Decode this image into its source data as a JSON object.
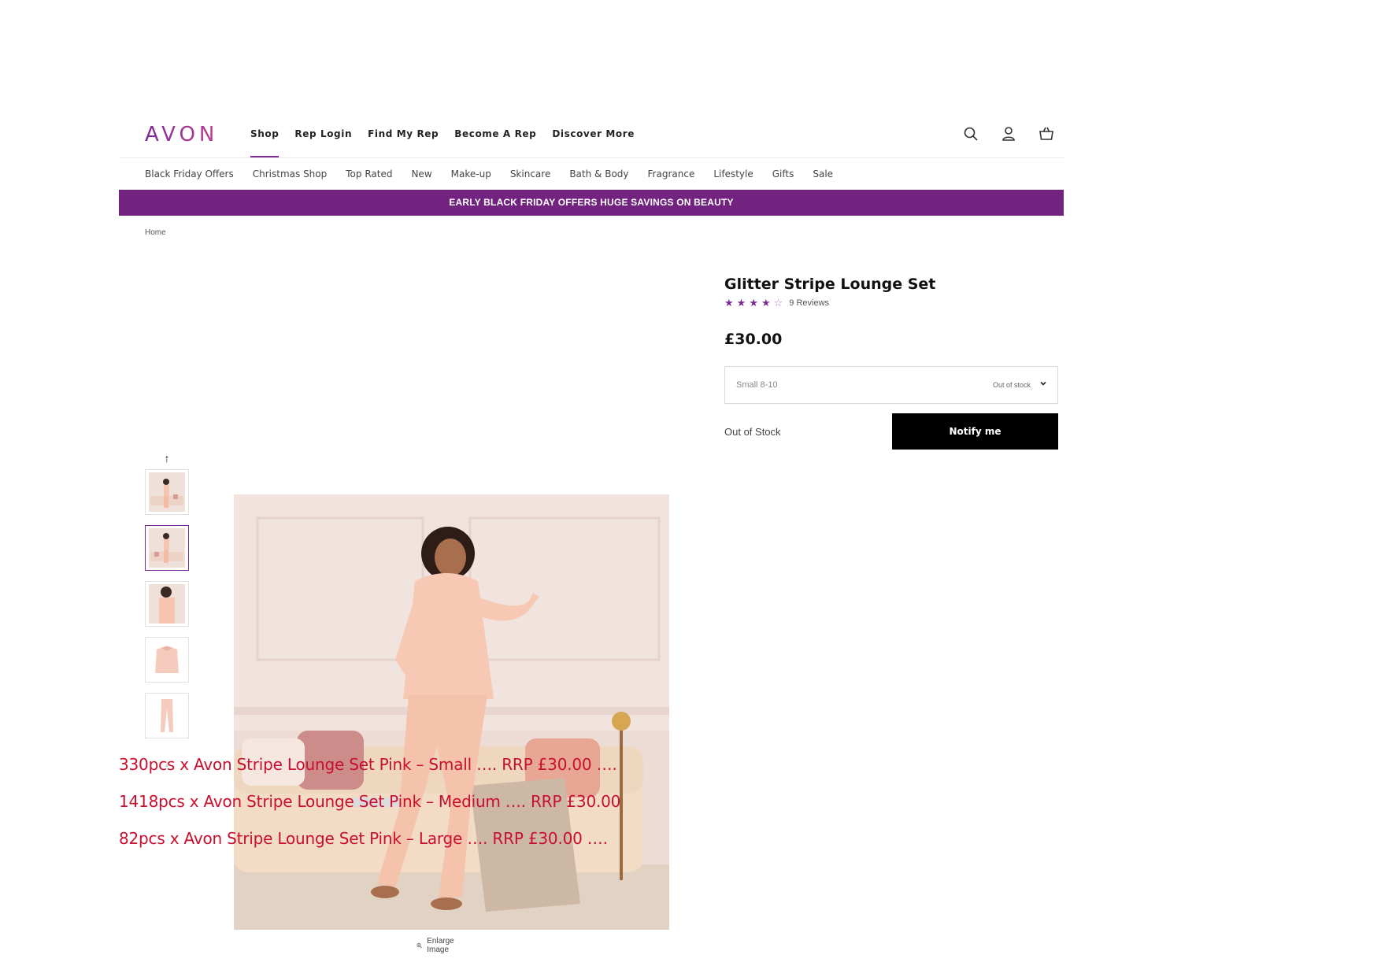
{
  "header": {
    "logo": "AVON",
    "nav": [
      "Shop",
      "Rep Login",
      "Find My Rep",
      "Become A Rep",
      "Discover More"
    ],
    "active_nav": "Shop",
    "icons": [
      "search-icon",
      "account-icon",
      "basket-icon"
    ]
  },
  "categories": [
    "Black Friday Offers",
    "Christmas Shop",
    "Top Rated",
    "New",
    "Make-up",
    "Skincare",
    "Bath & Body",
    "Fragrance",
    "Lifestyle",
    "Gifts",
    "Sale"
  ],
  "promo": "EARLY BLACK FRIDAY OFFERS  HUGE SAVINGS ON BEAUTY",
  "breadcrumb": "Home",
  "gallery": {
    "enlarge_label": "Enlarge Image",
    "selected_thumb": 2,
    "thumb_count": 5
  },
  "product": {
    "title": "Glitter Stripe Lounge Set",
    "rating": 4,
    "rating_max": 5,
    "reviews": "9 Reviews",
    "price": "£30.00",
    "size_value": "Small 8-10",
    "size_stock": "Out of stock",
    "availability": "Out of Stock",
    "notify_label": "Notify me"
  },
  "stock_lines": [
    "330pcs x Avon Stripe Lounge Set Pink – Small …. RRP £30.00 ….",
    "1418pcs x Avon Stripe Lounge Set Pink – Medium …. RRP £30.00",
    "82pcs x Avon Stripe Lounge Set Pink – Large …. RRP £30.00 …."
  ],
  "colors": {
    "brand_purple": "#72237f",
    "accent": "#7a2b96",
    "stock_text": "#c8102e"
  }
}
